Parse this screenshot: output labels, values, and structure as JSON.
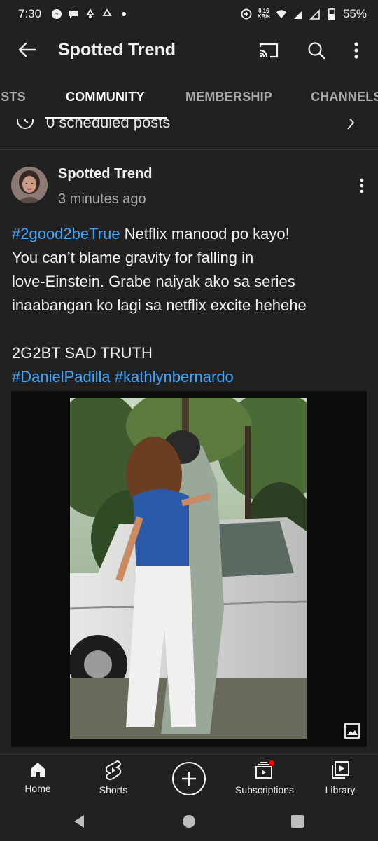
{
  "status_bar": {
    "time": "7:30",
    "net_speed_value": "0.16",
    "net_speed_unit": "KB/s",
    "battery": "55%"
  },
  "app_bar": {
    "title": "Spotted Trend"
  },
  "tabs": [
    {
      "label": "ISTS"
    },
    {
      "label": "COMMUNITY"
    },
    {
      "label": "MEMBERSHIP"
    },
    {
      "label": "CHANNELS"
    }
  ],
  "scheduled": {
    "label": "0 scheduled posts"
  },
  "post": {
    "author": "Spotted Trend",
    "time": "3 minutes ago",
    "hashtag1": "#2good2beTrue",
    "line1_rest": " Netflix manood po kayo!",
    "line2": "You can’t blame gravity for falling in",
    "line3": "love-Einstein. Grabe naiyak ako sa series",
    "line4": "inaabangan ko lagi sa netflix excite hehehe",
    "line5": "2G2BT SAD TRUTH",
    "hashtag2": "#DanielPadilla",
    "hashtag3": "#kathlynbernardo"
  },
  "bottom_nav": [
    {
      "label": "Home"
    },
    {
      "label": "Shorts"
    },
    {
      "label": "Subscriptions"
    },
    {
      "label": "Library"
    }
  ],
  "colors": {
    "background": "#212121",
    "link": "#3ea6ff",
    "notification_dot": "#ff0000"
  }
}
